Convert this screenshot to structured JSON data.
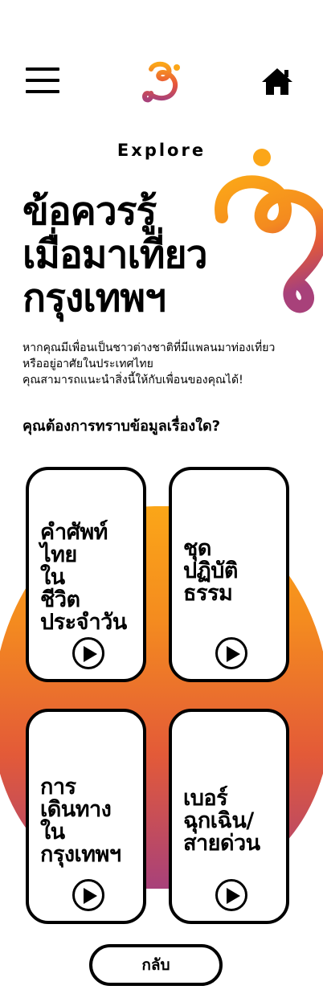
{
  "header": {
    "menu_icon": "hamburger-menu-icon",
    "logo_icon": "swirl-logo-icon",
    "home_icon": "home-icon",
    "brand_colors": {
      "orange": "#fba618",
      "red": "#e35a38",
      "purple": "#a8417a"
    }
  },
  "explore_label": "Explore",
  "title": {
    "line1": "ข้อควรรู้",
    "line2": "เมื่อมาเที่ยว",
    "line3": "กรุงเทพฯ"
  },
  "description": {
    "line1": "หากคุณมีเพื่อนเป็นชาวต่างชาติที่มีแพลนมาท่องเที่ยว",
    "line2": "หรืออยู่อาศัยในประเทศไทย",
    "line3": "คุณสามารถแนะนำสิ่งนี้ให้กับเพื่อนของคุณได้!"
  },
  "question": "คุณต้องการทราบข้อมูลเรื่องใด?",
  "cards": [
    {
      "lines": [
        "คำศัพท์",
        "ไทย",
        "ใน",
        "ชีวิต",
        "ประจำวัน"
      ],
      "play_icon": "play-icon"
    },
    {
      "lines": [
        "ชุด",
        "ปฏิบัติ",
        "ธรรม"
      ],
      "play_icon": "play-icon"
    },
    {
      "lines": [
        "การ",
        "เดินทาง",
        "ใน",
        "กรุงเทพฯ"
      ],
      "play_icon": "play-icon"
    },
    {
      "lines": [
        "เบอร์",
        "ฉุกเฉิน/",
        "สายด่วน"
      ],
      "play_icon": "play-icon"
    }
  ],
  "back_label": "กลับ"
}
